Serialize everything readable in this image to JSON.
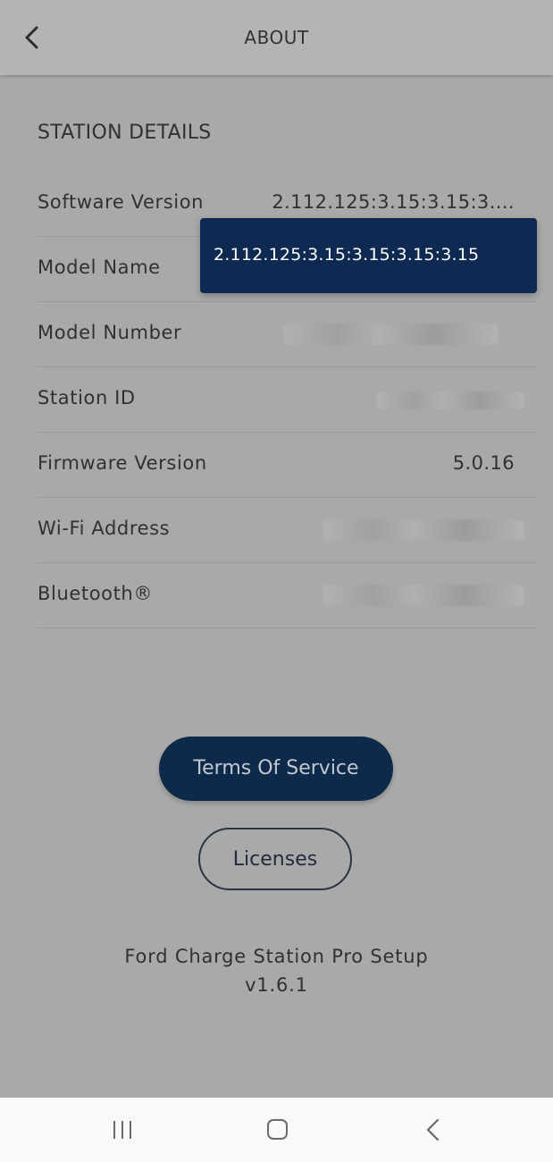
{
  "header": {
    "title": "ABOUT",
    "back_icon": "chevron-left-icon"
  },
  "section": {
    "title": "STATION DETAILS"
  },
  "details": [
    {
      "label": "Software Version",
      "value": "2.112.125:3.15:3.15:3...."
    },
    {
      "label": "Model Name",
      "value": ""
    },
    {
      "label": "Model Number",
      "value": ""
    },
    {
      "label": "Station ID",
      "value": ""
    },
    {
      "label": "Firmware Version",
      "value": "5.0.16"
    },
    {
      "label": "Wi-Fi Address",
      "value": ""
    },
    {
      "label": "Bluetooth®",
      "value": ""
    }
  ],
  "tooltip": {
    "text": "2.112.125:3.15:3.15:3.15:3.15"
  },
  "buttons": {
    "terms": "Terms Of Service",
    "licenses": "Licenses"
  },
  "footer": {
    "app_name": "Ford Charge Station Pro Setup",
    "version": "v1.6.1"
  },
  "nav": {
    "recents_icon": "recents-icon",
    "home_icon": "home-icon",
    "back_icon": "back-icon"
  },
  "colors": {
    "overlay_background": "#a9a9a9",
    "tooltip_background": "#0e2a52",
    "primary_button": "#0e2a4a",
    "nav_bar": "#f9f9f9"
  }
}
